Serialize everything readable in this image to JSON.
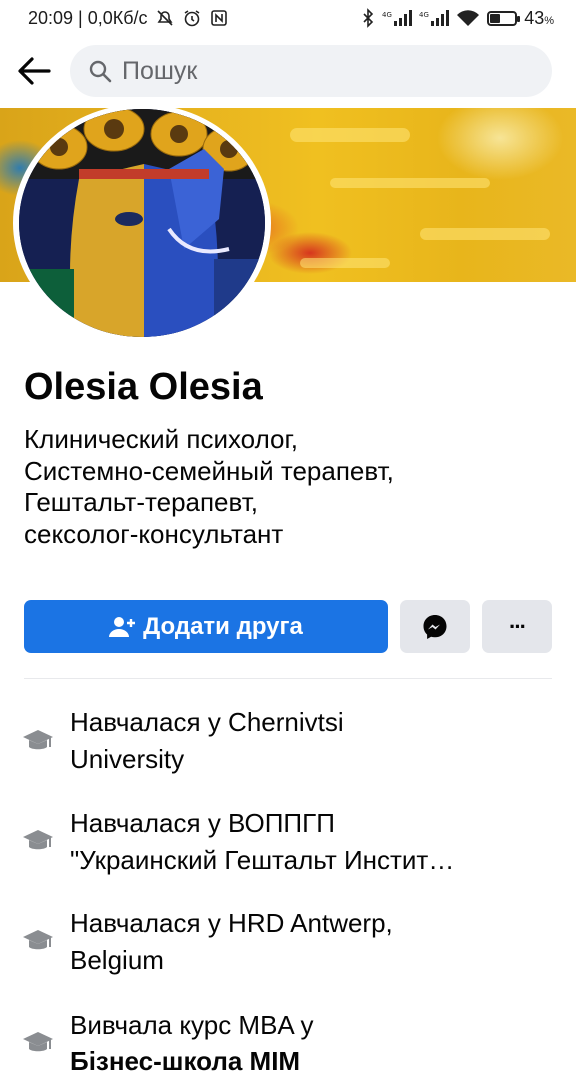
{
  "status_bar": {
    "time_speed": "20:09 | 0,0Кб/с",
    "battery_percent": "43",
    "battery_unit": "%",
    "battery_level": 0.43
  },
  "search": {
    "placeholder": "Пошук"
  },
  "profile": {
    "name": "Olesia Olesia",
    "bio_lines": [
      "Клинический психолог,",
      "Системно-семейный терапевт,",
      "Гештальт-терапевт,",
      "сексолог-консультант"
    ]
  },
  "actions": {
    "add_friend_label": "Додати друга",
    "more_label": "···"
  },
  "education": [
    {
      "line1": "Навчалася у Chernivtsi",
      "line2": "University",
      "line2_bold": false
    },
    {
      "line1": "Навчалася у ВОППГП",
      "line2": "\"Украинский Гештальт Инстит…",
      "line2_bold": false
    },
    {
      "line1": "Навчалася у HRD Antwerp,",
      "line2": "Belgium",
      "line2_bold": false
    },
    {
      "line1": "Вивчала курс MBA  у",
      "line2": "Бізнес-школа MIM",
      "line2_bold": true
    }
  ],
  "colors": {
    "accent": "#1b74e4",
    "grey_button": "#e4e6eb",
    "icon_grey": "#8a8d91"
  }
}
